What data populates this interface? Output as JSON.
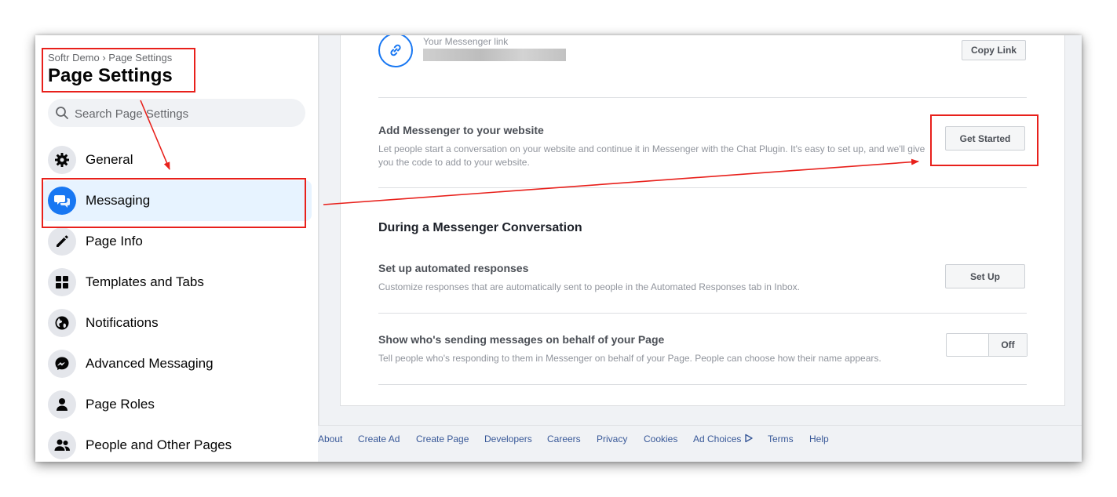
{
  "sidebar": {
    "breadcrumb": "Softr Demo › Page Settings",
    "title": "Page Settings",
    "search_placeholder": "Search Page Settings",
    "items": [
      {
        "label": "General",
        "icon": "gear-icon"
      },
      {
        "label": "Messaging",
        "icon": "chat-bubbles-icon",
        "active": true
      },
      {
        "label": "Page Info",
        "icon": "pencil-icon"
      },
      {
        "label": "Templates and Tabs",
        "icon": "grid-icon"
      },
      {
        "label": "Notifications",
        "icon": "globe-icon"
      },
      {
        "label": "Advanced Messaging",
        "icon": "messenger-icon"
      },
      {
        "label": "Page Roles",
        "icon": "person-icon"
      },
      {
        "label": "People and Other Pages",
        "icon": "people-icon"
      }
    ]
  },
  "main": {
    "messenger_link": {
      "caption": "Your Messenger link",
      "copy_button": "Copy Link"
    },
    "add_messenger": {
      "title": "Add Messenger to your website",
      "description": "Let people start a conversation on your website and continue it in Messenger with the Chat Plugin. It's easy to set up, and we'll give you the code to add to your website.",
      "button": "Get Started"
    },
    "conversation_heading": "During a Messenger Conversation",
    "automated": {
      "title": "Set up automated responses",
      "description": "Customize responses that are automatically sent to people in the Automated Responses tab in Inbox.",
      "button": "Set Up"
    },
    "show_sender": {
      "title": "Show who's sending messages on behalf of your Page",
      "description": "Tell people who's responding to them in Messenger on behalf of your Page. People can choose how their name appears.",
      "toggle_state": "Off"
    }
  },
  "footer": {
    "links": [
      "About",
      "Create Ad",
      "Create Page",
      "Developers",
      "Careers",
      "Privacy",
      "Cookies",
      "Ad Choices",
      "Terms",
      "Help"
    ]
  },
  "colors": {
    "accent": "#1877f2",
    "annotation": "#e8201b",
    "active_bg": "#e7f3ff"
  }
}
